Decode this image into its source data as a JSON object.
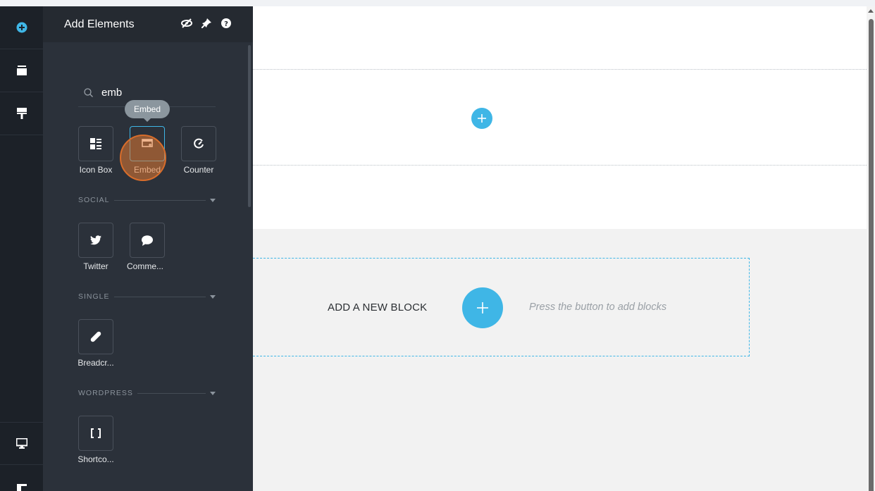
{
  "rail": {
    "icons": [
      "add-circle-icon",
      "layers-icon",
      "paint-roller-icon",
      "desktop-icon",
      "page-icon"
    ]
  },
  "panel": {
    "title": "Add Elements",
    "tools": [
      "eye-slash-icon",
      "pin-icon",
      "help-icon"
    ],
    "search": {
      "value": "emb"
    },
    "tooltip": "Embed",
    "results": [
      {
        "label": "Icon Box",
        "icon": "icon-box-icon"
      },
      {
        "label": "Embed",
        "icon": "embed-icon"
      },
      {
        "label": "Counter",
        "icon": "counter-icon"
      }
    ],
    "sections": [
      {
        "title": "SOCIAL",
        "items": [
          {
            "label": "Twitter",
            "icon": "twitter-icon"
          },
          {
            "label": "Comme...",
            "icon": "comment-icon"
          }
        ]
      },
      {
        "title": "SINGLE",
        "items": [
          {
            "label": "Breadcr...",
            "icon": "breadcrumb-icon"
          }
        ]
      },
      {
        "title": "WORDPRESS",
        "items": [
          {
            "label": "Shortco...",
            "icon": "shortcode-icon"
          }
        ]
      }
    ]
  },
  "canvas": {
    "add_block_title": "ADD A NEW BLOCK",
    "add_block_hint": "Press the button to add blocks"
  },
  "colors": {
    "accent": "#3fb6e6",
    "panel": "#2b313a",
    "rail": "#1c2128",
    "click_marker": "#d86d2b"
  }
}
